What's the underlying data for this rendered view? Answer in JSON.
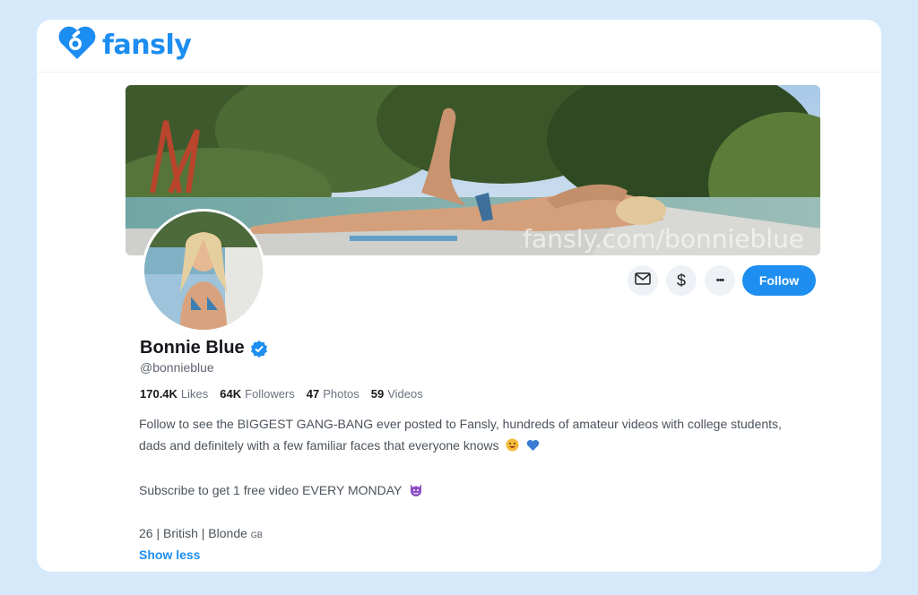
{
  "brand": {
    "name": "fansly",
    "accent": "#1e8ff0",
    "logo_icon": "heart-lock-icon"
  },
  "banner": {
    "watermark": "fansly.com/bonnieblue"
  },
  "actions": {
    "message_icon": "envelope-icon",
    "tip_icon": "dollar-icon",
    "more_icon": "more-dots-icon",
    "dollar_symbol": "$",
    "more_symbol": "•••",
    "follow_label": "Follow"
  },
  "profile": {
    "display_name": "Bonnie Blue",
    "verified": true,
    "handle": "@bonnieblue",
    "stats": [
      {
        "value": "170.4K",
        "label": "Likes"
      },
      {
        "value": "64K",
        "label": "Followers"
      },
      {
        "value": "47",
        "label": "Photos"
      },
      {
        "value": "59",
        "label": "Videos"
      }
    ],
    "bio": {
      "line1": "Follow to see the BIGGEST GANG-BANG ever posted to Fansly, hundreds of amateur videos with college students,",
      "line2": "dads and definitely with a few familiar faces that everyone knows",
      "line2_emojis": [
        "grinning-face-icon",
        "blue-heart-icon"
      ],
      "line3": "Subscribe to get 1 free video EVERY MONDAY",
      "line3_emoji": "purple-devil-icon",
      "line4": "26 | British | Blonde",
      "flag": "GB"
    },
    "show_less_label": "Show less"
  }
}
